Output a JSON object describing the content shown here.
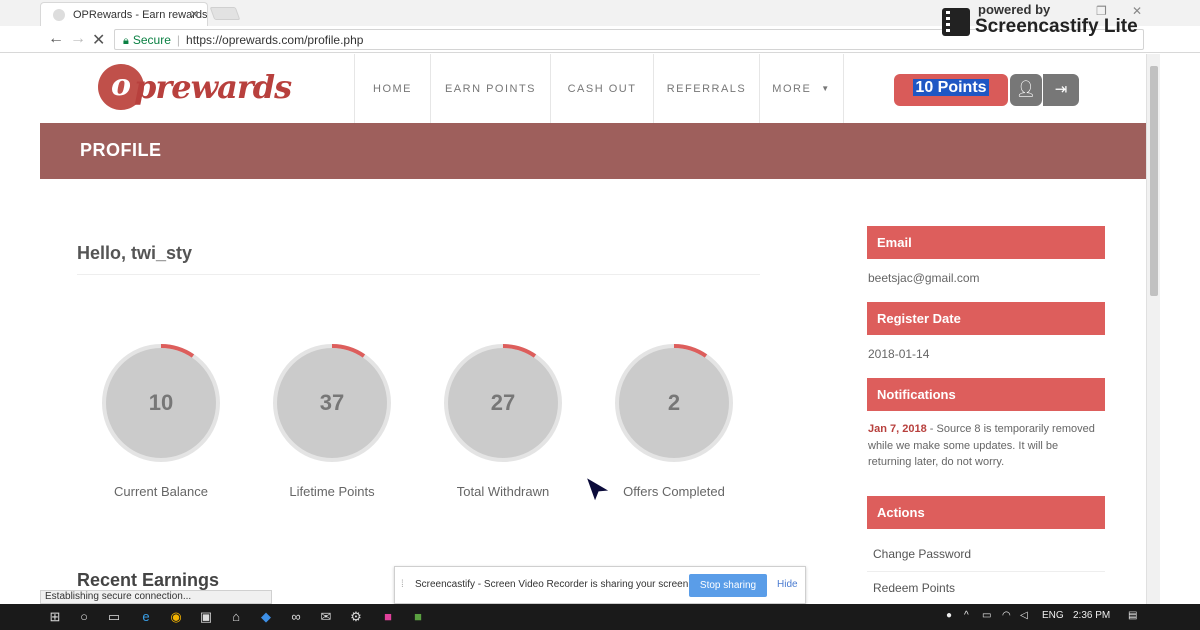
{
  "browser": {
    "tab_title": "OPRewards - Earn rewards",
    "secure_label": "Secure",
    "url": "https://oprewards.com/profile.php",
    "status_text": "Establishing secure connection..."
  },
  "overlay": {
    "powered_by": "powered by",
    "brand": "Screencastify Lite"
  },
  "site": {
    "logo_letter": "o",
    "logo_text": "prewards",
    "nav": [
      "HOME",
      "EARN POINTS",
      "CASH OUT",
      "REFERRALS",
      "MORE"
    ],
    "points": "10 Points"
  },
  "page": {
    "banner_title": "PROFILE",
    "greeting": "Hello, twi_sty",
    "stats": [
      {
        "value": "10",
        "label": "Current Balance"
      },
      {
        "value": "37",
        "label": "Lifetime Points"
      },
      {
        "value": "27",
        "label": "Total Withdrawn"
      },
      {
        "value": "2",
        "label": "Offers Completed"
      }
    ],
    "recent_heading": "Recent Earnings"
  },
  "sidebar": {
    "email_heading": "Email",
    "email": "beetsjac@gmail.com",
    "register_heading": "Register Date",
    "register_date": "2018-01-14",
    "notifications_heading": "Notifications",
    "notification_date": "Jan 7, 2018",
    "notification_text": " - Source 8 is temporarily removed while we make some updates. It will be returning later, do not worry.",
    "actions_heading": "Actions",
    "actions": [
      "Change Password",
      "Redeem Points"
    ]
  },
  "share_bar": {
    "message": "Screencastify - Screen Video Recorder is sharing your screen.",
    "stop_label": "Stop sharing",
    "hide_label": "Hide"
  },
  "taskbar": {
    "language": "ENG",
    "time": "2:36 PM"
  },
  "colors": {
    "brand_red": "#dd5e5c",
    "banner": "#9e5f5c",
    "selection_blue": "#1f57c4"
  }
}
